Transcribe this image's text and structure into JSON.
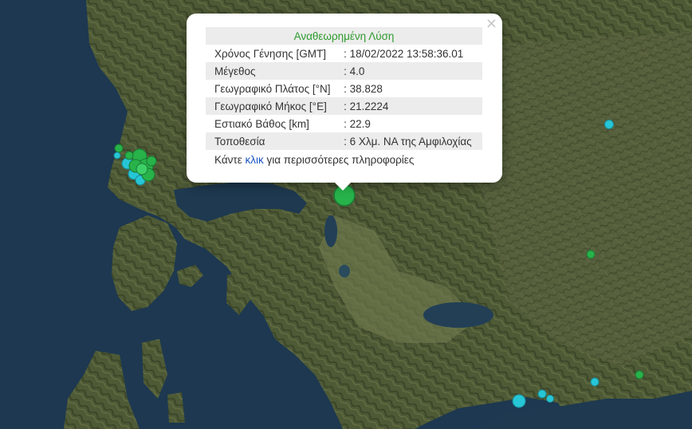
{
  "popup": {
    "title": "Αναθεωρημένη Λύση",
    "close_symbol": "×",
    "rows": [
      {
        "label": "Χρόνος Γένησης [GMT]",
        "value": ": 18/02/2022 13:58:36.01"
      },
      {
        "label": "Μέγεθος",
        "value": ": 4.0"
      },
      {
        "label": "Γεωγραφικό Πλάτος [°N]",
        "value": ": 38.828"
      },
      {
        "label": "Γεωγραφικό Μήκος [°E]",
        "value": ": 21.2224"
      },
      {
        "label": "Εστιακό Βάθος [km]",
        "value": ": 22.9"
      },
      {
        "label": "Τοποθεσία",
        "value": ": 6 Χλμ. ΝΑ της Αμφιλοχίας"
      }
    ],
    "footer_prefix": "Κάντε ",
    "footer_link": "κλικ",
    "footer_suffix": " για περισσότερες πληροφορίες"
  },
  "colors": {
    "sea": "#1e3950",
    "land": "#4f5b37",
    "land_dark": "#3a4428",
    "green_marker": "#27b24a",
    "cyan_marker": "#26c6d6"
  },
  "icons": [
    "close-icon",
    "earthquake-marker"
  ]
}
